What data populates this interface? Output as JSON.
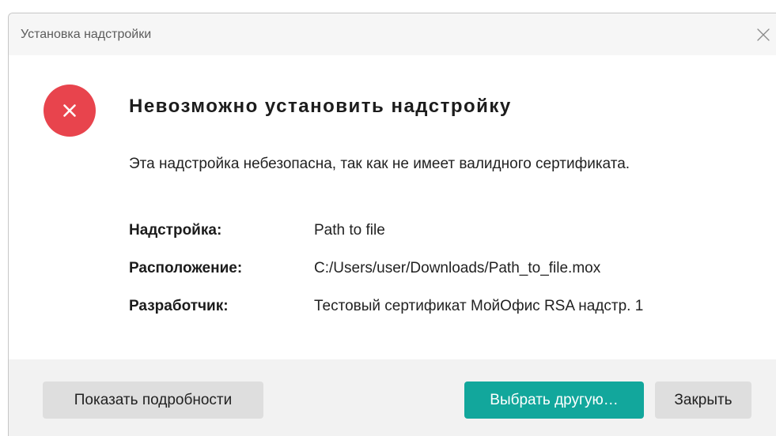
{
  "window": {
    "title": "Установка надстройки",
    "close_icon": "close-icon"
  },
  "error": {
    "icon": "error-icon",
    "heading": "Невозможно установить надстройку",
    "message": "Эта надстройка небезопасна, так как не имеет валидного сертификата."
  },
  "details": [
    {
      "label": "Надстройка:",
      "value": "Path to file"
    },
    {
      "label": "Расположение:",
      "value": "C:/Users/user/Downloads/Path_to_file.mox"
    },
    {
      "label": "Разработчик:",
      "value": "Тестовый сертификат МойОфис RSA надстр. 1"
    }
  ],
  "footer": {
    "details_button": "Показать подробности",
    "choose_button": "Выбрать другую…",
    "close_button": "Закрыть"
  },
  "colors": {
    "accent": "#12a79c",
    "error": "#e8444d"
  }
}
